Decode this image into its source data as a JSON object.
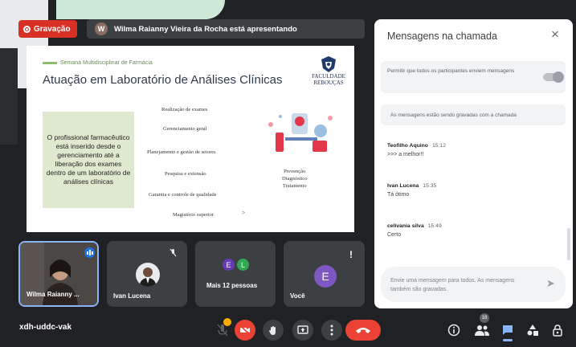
{
  "meeting": {
    "recording_label": "Gravação",
    "presenter_initial": "W",
    "presenting_text": "Wilma Raianny Vieira da Rocha está apresentando",
    "code": "xdh-uddc-vak"
  },
  "slide": {
    "subtitle": "Semana Multidisciplinar de Farmácia",
    "title": "Atuação em Laboratório de Análises Clínicas",
    "logo_text_1": "FACULDADE",
    "logo_text_2": "REBOUÇAS",
    "box_text": "O profissional farmacêutico está inserido desde o gerenciamento até a liberação dos exames dentro de um laboratório de análises clínicas",
    "items": [
      "Realização de exames",
      "Gerenciamento geral",
      "Planejamento e gestão de setores",
      "Pesquisa e extensão",
      "Garantia e controle de qualidade",
      "Magistério superior"
    ],
    "right_items": [
      "Prevenção",
      "Diagnóstico",
      "Tratamento"
    ],
    "arrow": ">"
  },
  "chat": {
    "title": "Mensagens na chamada",
    "toggle_label": "Permitir que todos os participantes enviem mensagens",
    "toggle_on": false,
    "info": "As mensagens estão sendo gravadas com a chamada",
    "messages": [
      {
        "sender": "Teofilho Aquino",
        "time": "15:12",
        "text": ">>> a melhor!!"
      },
      {
        "sender": "Ivan Lucena",
        "time": "15:35",
        "text": "Tá ótimo"
      },
      {
        "sender": "celivania silva",
        "time": "15:49",
        "text": "Certo"
      }
    ],
    "input_placeholder": "Envie uma mensagem para todos. As mensagens também são gravadas."
  },
  "participants": {
    "tiles": [
      {
        "name": "Wilma Raianny ..."
      },
      {
        "name": "Ivan Lucena"
      },
      {
        "name": "Mais 12 pessoas",
        "initials": [
          "E",
          "L"
        ]
      },
      {
        "name": "Você",
        "initial": "E"
      }
    ],
    "count_badge": "18"
  },
  "colors": {
    "accent_blue": "#8ab4f8",
    "record_red": "#d93025",
    "hangup_red": "#ea4335",
    "avatar_purple": "#673ab7",
    "avatar_green": "#33a852",
    "avatar_violet": "#7e57c2"
  },
  "icons": {
    "mic": "mic-off-icon",
    "camera": "camera-off-icon",
    "hand": "raise-hand-icon",
    "present": "present-screen-icon",
    "more": "more-options-icon",
    "hangup": "hangup-icon",
    "info": "info-icon",
    "people": "people-icon",
    "chat": "chat-icon",
    "activities": "activities-icon",
    "lock": "host-controls-icon"
  }
}
